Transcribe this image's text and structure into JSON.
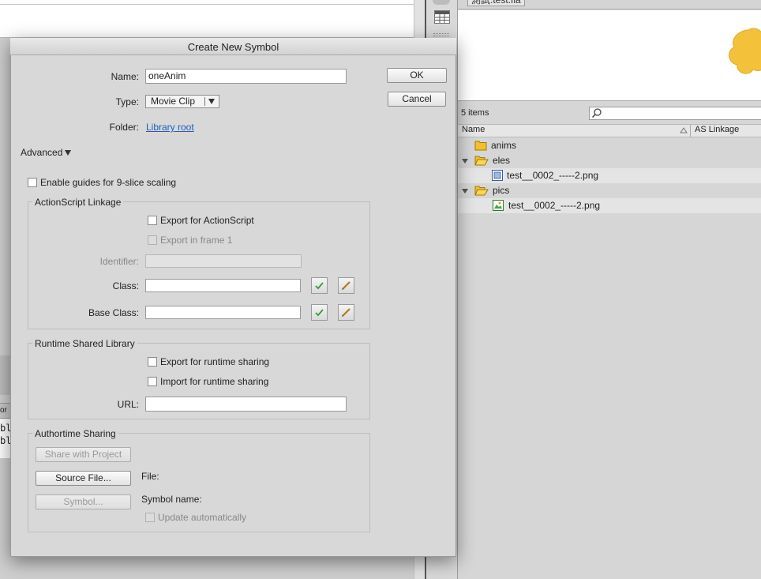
{
  "library": {
    "document_tab": "測試.test.fla",
    "item_count": "5 items",
    "search_placeholder": "",
    "col_name": "Name",
    "col_linkage": "AS Linkage",
    "rows": [
      {
        "label": "anims"
      },
      {
        "label": "eles"
      },
      {
        "label": "test__0002_-----2.png"
      },
      {
        "label": "pics"
      },
      {
        "label": "test__0002_-----2.png"
      }
    ]
  },
  "background": {
    "panel_tab": "or",
    "code_lines": [
      "bl",
      "bl"
    ]
  },
  "dialog": {
    "title": "Create New Symbol",
    "name_label": "Name:",
    "name_value": "oneAnim",
    "type_label": "Type:",
    "type_value": "Movie Clip",
    "folder_label": "Folder:",
    "folder_value": "Library root",
    "ok": "OK",
    "cancel": "Cancel",
    "advanced": "Advanced",
    "nine_slice": "Enable guides for 9-slice scaling",
    "as_linkage": {
      "title": "ActionScript Linkage",
      "export_as": "Export for ActionScript",
      "export_frame1": "Export in frame 1",
      "identifier": "Identifier:",
      "class": "Class:",
      "base_class": "Base Class:"
    },
    "rsl": {
      "title": "Runtime Shared Library",
      "export_runtime": "Export for runtime sharing",
      "import_runtime": "Import for runtime sharing",
      "url": "URL:"
    },
    "authortime": {
      "title": "Authortime Sharing",
      "share_project": "Share with Project",
      "source_file": "Source File...",
      "file": "File:",
      "symbol": "Symbol...",
      "symbol_name": "Symbol name:",
      "update_auto": "Update automatically"
    }
  },
  "colors": {
    "link": "#1f5fb8",
    "check_green": "#3c9a3c",
    "folder_yellow": "#f0c030"
  }
}
